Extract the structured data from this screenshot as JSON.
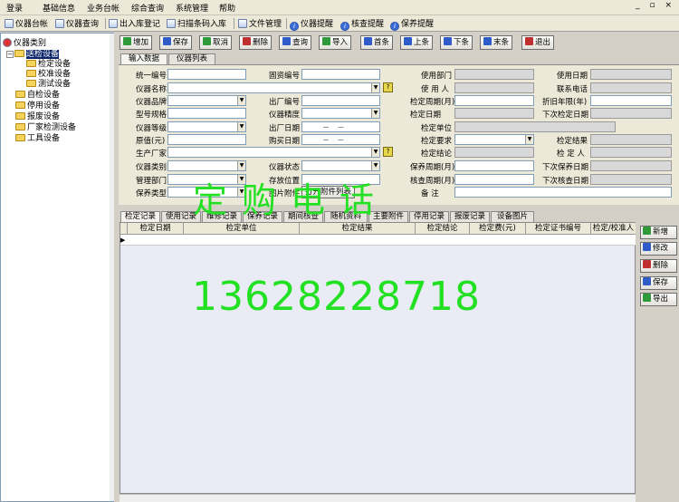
{
  "menu": [
    "登录",
    "基础信息",
    "业务台帐",
    "综合查询",
    "系统管理",
    "帮助"
  ],
  "window_controls": "_ ▫ ×",
  "top_toolbar": [
    "仪器台帐",
    "仪器查询",
    "出入库登记",
    "扫描条码入库",
    "文件管理",
    "仪器提醒",
    "核查提醒",
    "保养提醒"
  ],
  "tree": {
    "root": "仪器类别",
    "items": [
      "送检设备",
      "检定设备",
      "校准设备",
      "测试设备",
      "自检设备",
      "停用设备",
      "报废设备",
      "厂家检测设备",
      "工具设备"
    ]
  },
  "toolbar": [
    "增加",
    "保存",
    "取消",
    "删除",
    "查询",
    "导入",
    "首条",
    "上条",
    "下条",
    "末条",
    "退出"
  ],
  "form_tabs": [
    "输入数据",
    "仪器列表"
  ],
  "form": {
    "col1": [
      "统一编号",
      "仪器名称",
      "仪器品牌",
      "型号规格",
      "仪器等级",
      "原值(元)",
      "生产厂家",
      "仪器类别",
      "管理部门",
      "保养类型"
    ],
    "col2": [
      "固资编号",
      "出厂编号",
      "仪器精度",
      "出厂日期",
      "购买日期",
      "仪器状态",
      "存放位置",
      "图片附件"
    ],
    "col3": [
      "使用部门",
      "使 用 人",
      "检定日期",
      "检定周期(月)",
      "检定单位",
      "检定要求",
      "检定结论",
      "保养周期(月)",
      "核查周期(月)",
      "备    注"
    ],
    "col4": [
      "使用日期",
      "联系电话",
      "折旧年限(年)",
      "下次检定日期",
      "检定结果",
      "检 定 人",
      "下次保养日期",
      "下次核查日期"
    ],
    "date_placeholder": "－  －",
    "attach_button": "打开附件列表"
  },
  "overlay": {
    "top_text": "定购电话",
    "phone": "13628228718"
  },
  "record_tabs": [
    "检定记录",
    "使用记录",
    "维修记录",
    "保养记录",
    "期间核查",
    "随机资料",
    "主要附件",
    "停用记录",
    "报废记录",
    "设备图片"
  ],
  "grid_columns": [
    "检定日期",
    "检定单位",
    "检定结果",
    "检定结论",
    "检定费(元)",
    "检定证书编号",
    "检定/校准人"
  ],
  "grid_row_indicator": "▶",
  "side_buttons": [
    "新增",
    "修改",
    "删除",
    "保存",
    "导出"
  ]
}
